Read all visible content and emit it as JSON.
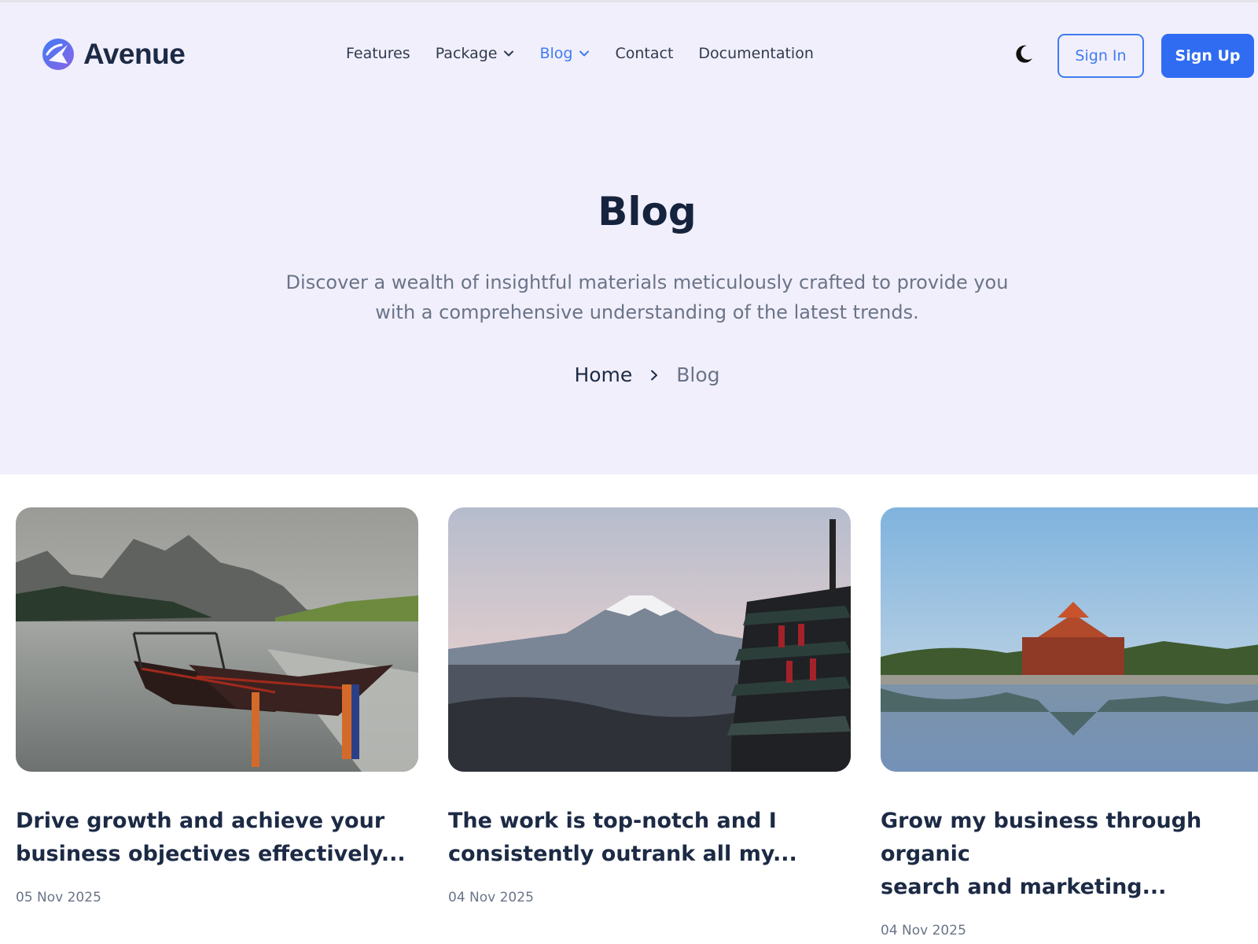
{
  "brand": {
    "name": "Avenue"
  },
  "nav": {
    "items": [
      {
        "label": "Features",
        "has_dropdown": false,
        "active": false
      },
      {
        "label": "Package",
        "has_dropdown": true,
        "active": false
      },
      {
        "label": "Blog",
        "has_dropdown": true,
        "active": true
      },
      {
        "label": "Contact",
        "has_dropdown": false,
        "active": false
      },
      {
        "label": "Documentation",
        "has_dropdown": false,
        "active": false
      }
    ]
  },
  "header": {
    "theme_toggle_icon": "moon-icon",
    "sign_in_label": "Sign In",
    "sign_up_label": "Sign Up"
  },
  "hero": {
    "title": "Blog",
    "description_line1": "Discover a wealth of insightful materials meticulously crafted to provide you",
    "description_line2": "with a comprehensive understanding of the latest trends."
  },
  "breadcrumb": {
    "home": "Home",
    "current": "Blog"
  },
  "posts": [
    {
      "title_line1": "Drive growth and achieve your",
      "title_line2": "business objectives effectively...",
      "date": "05 Nov 2025",
      "image": "boats-on-lake-photo"
    },
    {
      "title_line1": "The work is top-notch and I",
      "title_line2": "consistently outrank all my...",
      "date": "04 Nov 2025",
      "image": "mount-fuji-pagoda-photo"
    },
    {
      "title_line1": "Grow my business through organic",
      "title_line2": "search and marketing...",
      "date": "04 Nov 2025",
      "image": "forbidden-city-moat-photo"
    }
  ],
  "colors": {
    "accent": "#2f6cf2",
    "hero_background": "#f1effb",
    "heading": "#16233d",
    "muted_text": "#6a7488"
  }
}
